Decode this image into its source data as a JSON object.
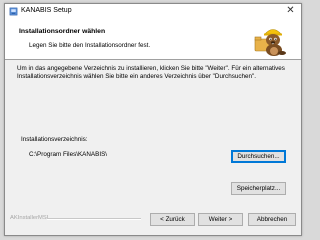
{
  "window": {
    "title": "KANABIS Setup",
    "close_glyph": "✕",
    "icon": "setup-icon"
  },
  "header": {
    "title": "Installationsordner wählen",
    "subtitle": "Legen Sie bitte den Installationsordner fest.",
    "mascot": "beaver-mascot-icon"
  },
  "body": {
    "description": "Um in das angegebene Verzeichnis zu installieren, klicken Sie bitte \"Weiter\". Für ein alternatives Installationsverzeichnis wählen Sie bitte ein anderes Verzeichnis über \"Durchsuchen\".",
    "path_label": "Installationsverzeichnis:",
    "path_value": "C:\\Program Files\\KANABIS\\",
    "browse_label": "Durchsuchen...",
    "diskspace_label": "Speicherplatz..."
  },
  "footer": {
    "brand": "AKInstallerMSI",
    "back_label": "< Zurück",
    "next_label": "Weiter >",
    "cancel_label": "Abbrechen"
  },
  "colors": {
    "focus_border": "#0078d7",
    "brand_text": "#a6a6a6"
  }
}
